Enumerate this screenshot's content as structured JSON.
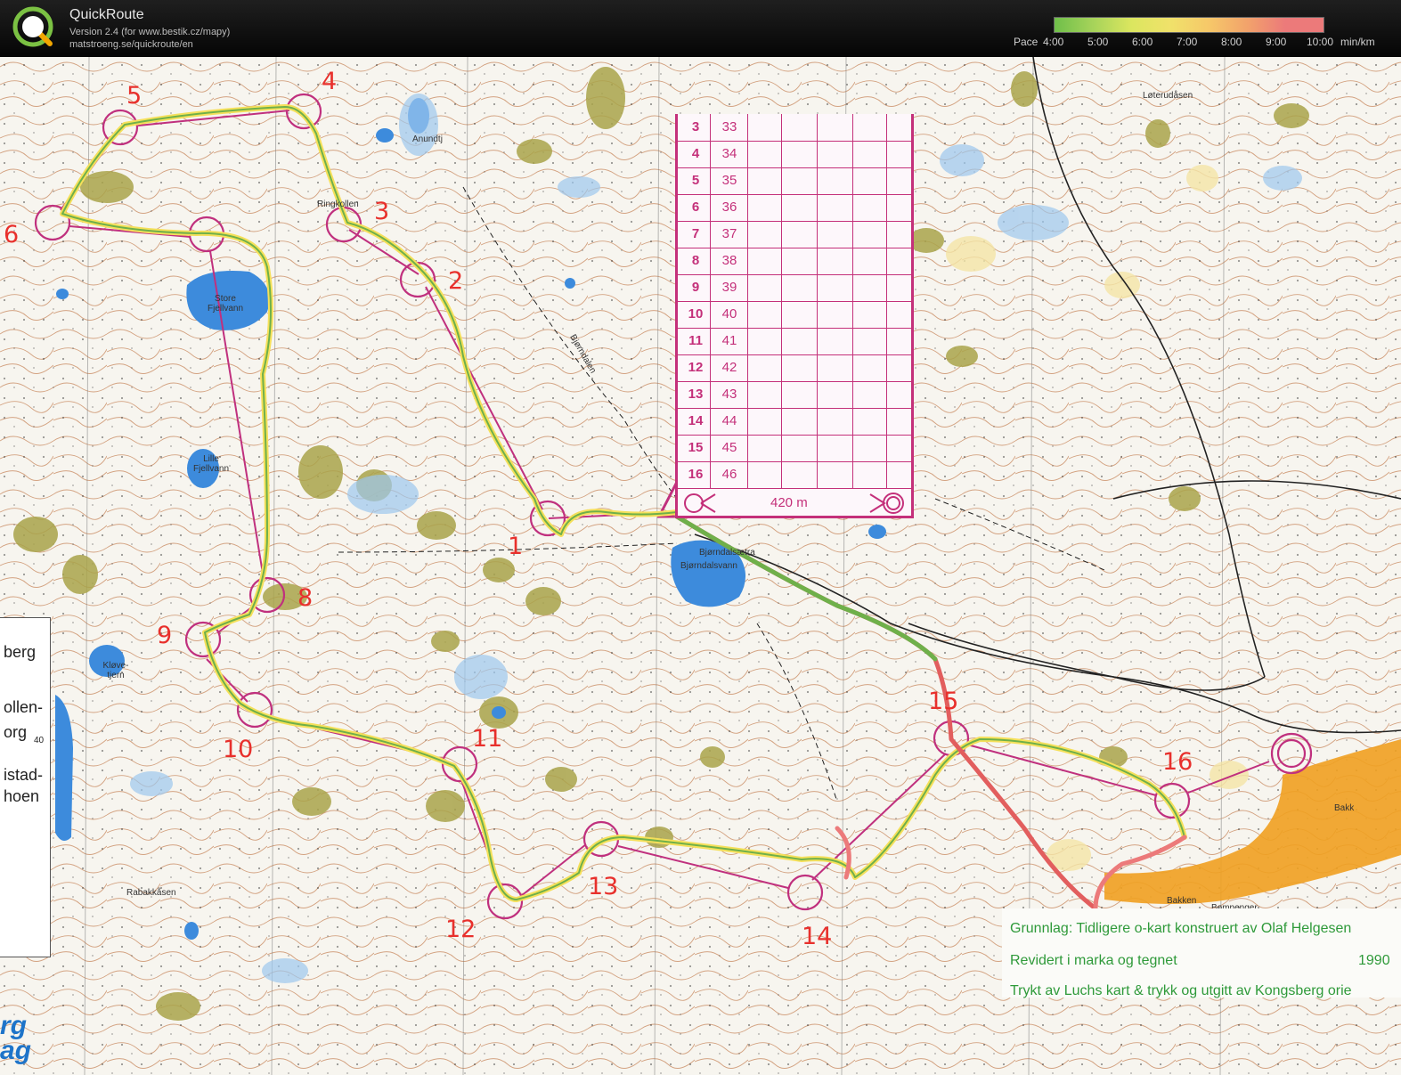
{
  "app": {
    "title": "QuickRoute",
    "version_line": "Version 2.4  (for www.bestik.cz/mapy)",
    "url_line": "matstroeng.se/quickroute/en",
    "logo_letter": "Q"
  },
  "pace": {
    "label": "Pace",
    "ticks": [
      "4:00",
      "5:00",
      "6:00",
      "7:00",
      "8:00",
      "9:00",
      "10:00"
    ],
    "unit": "min/km",
    "gradient_colors": [
      "#6fbf4a",
      "#a6d35a",
      "#dbe65f",
      "#f0e26a",
      "#f6c869",
      "#f2a36b",
      "#ec7a7a"
    ]
  },
  "course": {
    "control_table": [
      {
        "num": "3",
        "code": "33"
      },
      {
        "num": "4",
        "code": "34"
      },
      {
        "num": "5",
        "code": "35"
      },
      {
        "num": "6",
        "code": "36"
      },
      {
        "num": "7",
        "code": "37"
      },
      {
        "num": "8",
        "code": "38"
      },
      {
        "num": "9",
        "code": "39"
      },
      {
        "num": "10",
        "code": "40"
      },
      {
        "num": "11",
        "code": "41"
      },
      {
        "num": "12",
        "code": "42"
      },
      {
        "num": "13",
        "code": "43"
      },
      {
        "num": "14",
        "code": "44"
      },
      {
        "num": "15",
        "code": "45"
      },
      {
        "num": "16",
        "code": "46"
      }
    ],
    "finish_distance": "420 m",
    "control_labels": [
      "1",
      "2",
      "3",
      "4",
      "5",
      "6",
      "8",
      "9",
      "10",
      "11",
      "12",
      "13",
      "14",
      "15",
      "16"
    ]
  },
  "places": [
    "Anundtj",
    "Ringkollen",
    "Store Fjellvann",
    "Lille Fjellvann",
    "Kløve- tjern",
    "Bjørndalen",
    "Bjørndalsætra",
    "Bjørndalsvann",
    "Løterudåsen",
    "Rabakkåsen",
    "Bakken",
    "Bompenger",
    "Bakk"
  ],
  "legend_left": [
    "berg",
    "ollen-",
    "org",
    "40",
    "istad-",
    "hoen"
  ],
  "credits": {
    "line1": "Grunnlag: Tidligere o-kart konstruert av Olaf Helgesen",
    "line2": "Revidert i marka og tegnet",
    "line2_year": "1990",
    "line3": "Trykt av Luchs kart & trykk og utgitt av Kongsberg orie"
  },
  "bottom_org": [
    "rg",
    "ag"
  ]
}
